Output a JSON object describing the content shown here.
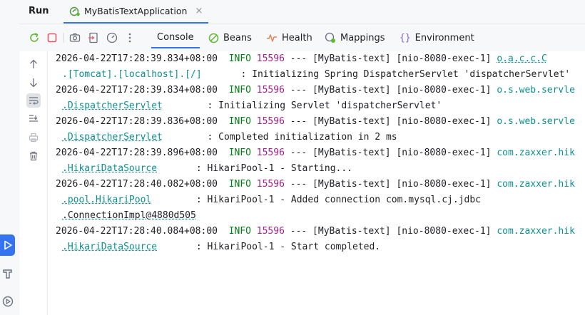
{
  "header": {
    "run_title": "Run",
    "tab_label": "MyBatisTextApplication",
    "close_glyph": "×"
  },
  "tabs": [
    {
      "label": "Console",
      "active": true
    },
    {
      "label": "Beans",
      "active": false
    },
    {
      "label": "Health",
      "active": false
    },
    {
      "label": "Mappings",
      "active": false
    },
    {
      "label": "Environment",
      "active": false
    }
  ],
  "console": {
    "lines": [
      {
        "ts": "2026-04-22T17:28:39.834+08:00",
        "level": "INFO",
        "pid": "15596",
        "mid": " --- [MyBatis-text] [nio-8080-exec-1] ",
        "logger": "o.a.c.c.C"
      },
      {
        "cont": ".[Tomcat].[localhost].[/]",
        "msg": "       : Initializing Spring DispatcherServlet 'dispatcherServlet'"
      },
      {
        "ts": "2026-04-22T17:28:39.834+08:00",
        "level": "INFO",
        "pid": "15596",
        "mid": " --- [MyBatis-text] [nio-8080-exec-1] ",
        "logger": "o.s.web.servle"
      },
      {
        "cont": ".DispatcherServlet",
        "msg": "        : Initializing Servlet 'dispatcherServlet'"
      },
      {
        "ts": "2026-04-22T17:28:39.836+08:00",
        "level": "INFO",
        "pid": "15596",
        "mid": " --- [MyBatis-text] [nio-8080-exec-1] ",
        "logger": "o.s.web.servle"
      },
      {
        "cont": ".DispatcherServlet",
        "msg": "        : Completed initialization in 2 ms"
      },
      {
        "ts": "2026-04-22T17:28:39.896+08:00",
        "level": "INFO",
        "pid": "15596",
        "mid": " --- [MyBatis-text] [nio-8080-exec-1] ",
        "logger": "com.zaxxer.hik"
      },
      {
        "cont": ".HikariDataSource",
        "msg": "       : HikariPool-1 - Starting..."
      },
      {
        "ts": "2026-04-22T17:28:40.082+08:00",
        "level": "INFO",
        "pid": "15596",
        "mid": " --- [MyBatis-text] [nio-8080-exec-1] ",
        "logger": "com.zaxxer.hik"
      },
      {
        "cont": ".pool.HikariPool",
        "msg": "        : HikariPool-1 - Added connection com.mysql.cj.jdbc"
      },
      {
        "cont": ".ConnectionImpl@4880d505",
        "msg": ""
      },
      {
        "ts": "2026-04-22T17:28:40.084+08:00",
        "level": "INFO",
        "pid": "15596",
        "mid": " --- [MyBatis-text] [nio-8080-exec-1] ",
        "logger": "com.zaxxer.hik"
      },
      {
        "cont": ".HikariDataSource",
        "msg": "       : HikariPool-1 - Start completed."
      }
    ]
  },
  "colors": {
    "accent": "#3574f0",
    "info": "#067d17",
    "pid": "#a0208d",
    "logger": "#0e8f8f",
    "stop": "#e55765"
  }
}
